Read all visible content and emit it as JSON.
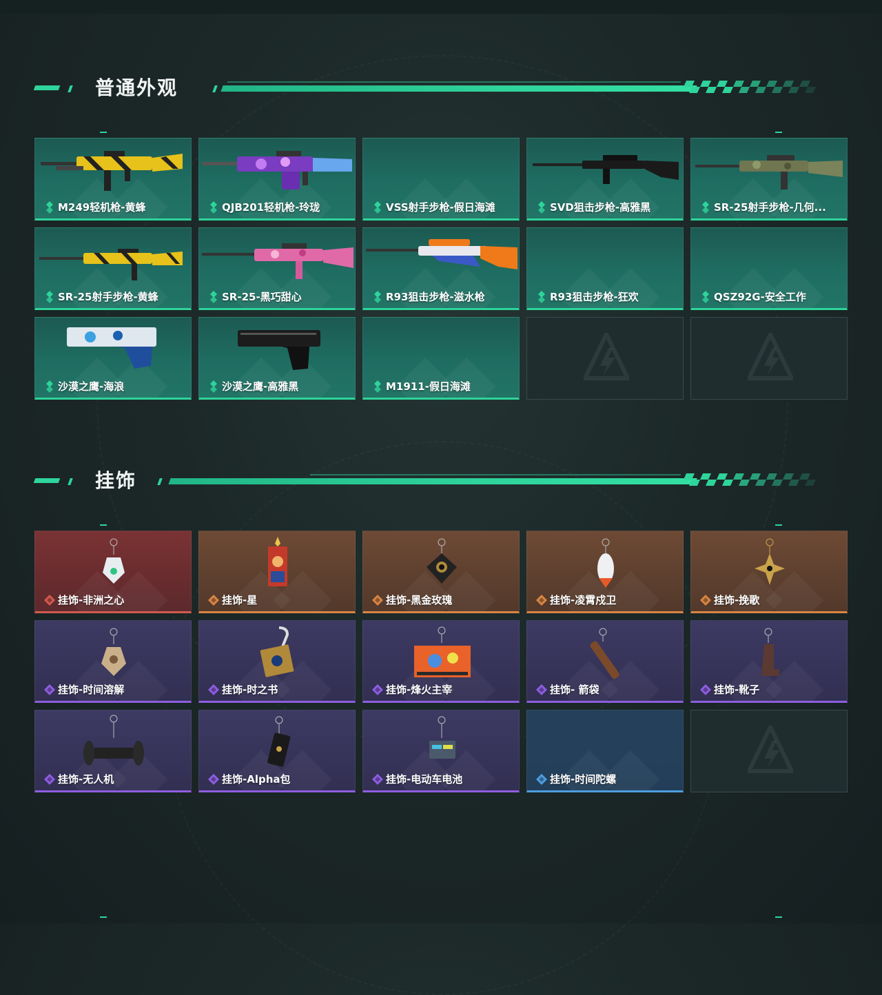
{
  "sections": [
    {
      "title": "普通外观",
      "items": [
        {
          "label": "M249轻机枪-黄蜂",
          "rarity": "green",
          "art": "rifle-yellow"
        },
        {
          "label": "QJB201轻机枪-玲珑",
          "rarity": "green",
          "art": "rifle-purple"
        },
        {
          "label": "VSS射手步枪-假日海滩",
          "rarity": "green",
          "art": "none"
        },
        {
          "label": "SVD狙击步枪-高雅黑",
          "rarity": "green",
          "art": "sniper-black"
        },
        {
          "label": "SR-25射手步枪-几何...",
          "rarity": "green",
          "art": "rifle-camo"
        },
        {
          "label": "SR-25射手步枪-黄蜂",
          "rarity": "green",
          "art": "rifle-yellow2"
        },
        {
          "label": "SR-25-黑巧甜心",
          "rarity": "green",
          "art": "rifle-pink"
        },
        {
          "label": "R93狙击步枪-滋水枪",
          "rarity": "green",
          "art": "sniper-orange"
        },
        {
          "label": "R93狙击步枪-狂欢",
          "rarity": "green",
          "art": "none"
        },
        {
          "label": "QSZ92G-安全工作",
          "rarity": "green",
          "art": "none"
        },
        {
          "label": "沙漠之鹰-海浪",
          "rarity": "green",
          "art": "pistol-blue"
        },
        {
          "label": "沙漠之鹰-高雅黑",
          "rarity": "green",
          "art": "pistol-black"
        },
        {
          "label": "M1911-假日海滩",
          "rarity": "green",
          "art": "none"
        },
        {
          "label": "",
          "rarity": "empty",
          "art": "logo"
        },
        {
          "label": "",
          "rarity": "empty",
          "art": "logo"
        }
      ]
    },
    {
      "title": "挂饰",
      "items": [
        {
          "label": "挂饰-非洲之心",
          "rarity": "red",
          "art": "charm-gem"
        },
        {
          "label": "挂饰-星",
          "rarity": "orange",
          "art": "charm-card"
        },
        {
          "label": "挂饰-黑金玫瑰",
          "rarity": "orange",
          "art": "charm-rose"
        },
        {
          "label": "挂饰-凌霄戍卫",
          "rarity": "orange",
          "art": "charm-rocket"
        },
        {
          "label": "挂饰-挽歌",
          "rarity": "orange",
          "art": "charm-cross"
        },
        {
          "label": "挂饰-时间溶解",
          "rarity": "purple",
          "art": "charm-clock"
        },
        {
          "label": "挂饰-时之书",
          "rarity": "purple",
          "art": "charm-book"
        },
        {
          "label": "挂饰-烽火主宰",
          "rarity": "purple",
          "art": "charm-poster"
        },
        {
          "label": "挂饰- 箭袋",
          "rarity": "purple",
          "art": "charm-quiver"
        },
        {
          "label": "挂饰-靴子",
          "rarity": "purple",
          "art": "charm-boot"
        },
        {
          "label": "挂饰-无人机",
          "rarity": "purple",
          "art": "charm-drone"
        },
        {
          "label": "挂饰-Alpha包",
          "rarity": "purple",
          "art": "charm-bag"
        },
        {
          "label": "挂饰-电动车电池",
          "rarity": "purple",
          "art": "charm-battery"
        },
        {
          "label": "挂饰-时间陀螺",
          "rarity": "blue",
          "art": "none"
        },
        {
          "label": "",
          "rarity": "empty",
          "art": "logo"
        }
      ]
    }
  ],
  "colors": {
    "accent": "#2fd49b",
    "green": "#2fd49b",
    "red": "#d35a4e",
    "orange": "#d98544",
    "purple": "#8d5ee0",
    "blue": "#4e9ee0"
  }
}
